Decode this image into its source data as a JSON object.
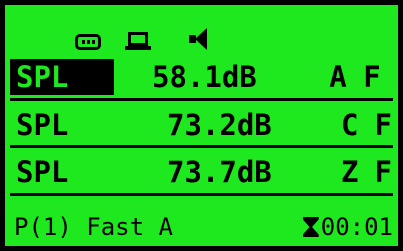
{
  "status_icons": [
    "memory-card-icon",
    "laptop-icon",
    "speaker-icon"
  ],
  "rows": [
    {
      "type": "SPL",
      "value": "58.1dB",
      "weighting": "A",
      "time": "F",
      "selected": true
    },
    {
      "type": "SPL",
      "value": "73.2dB",
      "weighting": "C",
      "time": "F",
      "selected": false
    },
    {
      "type": "SPL",
      "value": "73.7dB",
      "weighting": "Z",
      "time": "F",
      "selected": false
    }
  ],
  "footer": {
    "mode": "P(1) Fast A",
    "timer_icon": "hourglass-icon",
    "timer": "00:01"
  },
  "colors": {
    "background": "#1ee81e",
    "foreground": "#000000"
  }
}
